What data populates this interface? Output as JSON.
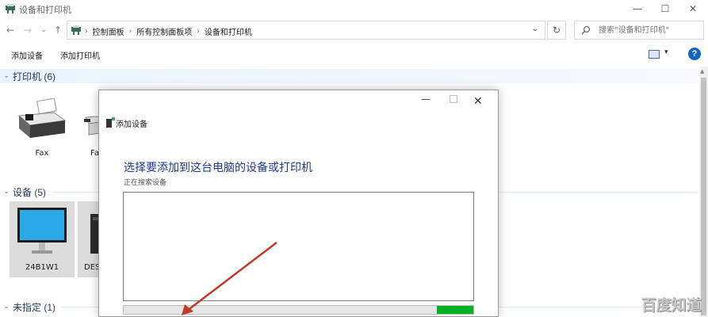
{
  "window": {
    "title": "设备和打印机",
    "minimize_icon": "minimize-icon",
    "maximize_icon": "maximize-icon",
    "close_icon": "close-icon",
    "min_glyph": "—",
    "max_glyph": "☐",
    "close_glyph": "✕"
  },
  "nav": {
    "back": "←",
    "forward": "→",
    "recent": "⌄",
    "up": "↑",
    "refresh": "↻"
  },
  "address": {
    "breadcrumbs": [
      "控制面板",
      "所有控制面板项",
      "设备和打印机"
    ],
    "separator": "›",
    "dropdown": "⌄"
  },
  "search": {
    "placeholder": "搜索\"设备和打印机\""
  },
  "commands": {
    "add_device": "添加设备",
    "add_printer": "添加打印机",
    "view_dropdown": "▾",
    "help": "?"
  },
  "groups": {
    "printers": {
      "title": "打印机 (6)",
      "chevron": "⌄"
    },
    "devices": {
      "title": "设备 (5)",
      "chevron": "⌄"
    },
    "unspecified": {
      "title": "未指定 (1)",
      "chevron": "⌄"
    }
  },
  "printer_items": [
    {
      "label": "Fax",
      "icon": "fax-icon"
    },
    {
      "label": "Fa",
      "icon": "printer-icon"
    }
  ],
  "device_items": [
    {
      "label": "24B1W1",
      "icon": "monitor-icon",
      "selected": true
    },
    {
      "label": "DES",
      "icon": "computer-icon",
      "selected": true
    }
  ],
  "dialog": {
    "title": "添加设备",
    "heading": "选择要添加到这台电脑的设备或打印机",
    "status": "正在搜索设备",
    "progress_segment": {
      "start": 0.895,
      "end": 1.0
    },
    "min_glyph": "—",
    "close_glyph": "✕"
  },
  "watermark": {
    "text": "百度知道"
  },
  "colors": {
    "accent": "#1565c0",
    "heading": "#1e3a8a",
    "progress": "#06b025",
    "arrow": "#c0392b"
  }
}
